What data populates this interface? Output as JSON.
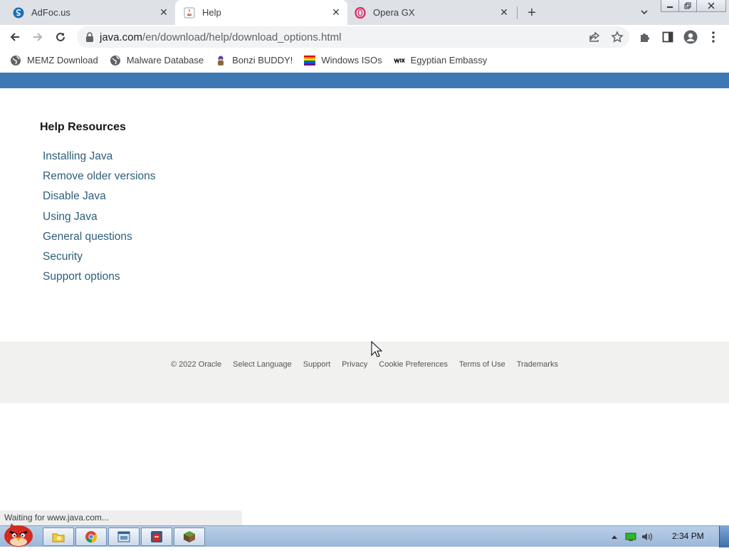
{
  "browser": {
    "tabs": [
      {
        "title": "AdFoc.us",
        "icon": "adfocus-icon",
        "active": false
      },
      {
        "title": "Help",
        "icon": "java-icon",
        "active": true
      },
      {
        "title": "Opera GX",
        "icon": "opera-icon",
        "active": false
      }
    ],
    "tab_close_glyph": "✕",
    "new_tab_glyph": "+",
    "url": {
      "host": "java.com",
      "path": "/en/download/help/download_options.html"
    },
    "bookmarks": [
      {
        "label": "MEMZ Download",
        "icon": "globe-icon"
      },
      {
        "label": "Malware Database",
        "icon": "globe-icon"
      },
      {
        "label": "Bonzi BUDDY!",
        "icon": "bonzi-icon"
      },
      {
        "label": "Windows ISOs",
        "icon": "rainbow-flag-icon"
      },
      {
        "label": "Egyptian Embassy",
        "icon": "wix-icon"
      }
    ]
  },
  "page": {
    "help_title": "Help Resources",
    "help_links": [
      "Installing Java",
      "Remove older versions",
      "Disable Java",
      "Using Java",
      "General questions",
      "Security",
      "Support options"
    ],
    "footer_links": [
      "© 2022 Oracle",
      "Select Language",
      "Support",
      "Privacy",
      "Cookie Preferences",
      "Terms of Use",
      "Trademarks"
    ],
    "banner_color": "#3f79b5",
    "link_color": "#2d5f7a"
  },
  "status": {
    "text": "Waiting for www.java.com..."
  },
  "taskbar": {
    "clock": "2:34 PM",
    "apps": [
      "explorer-icon",
      "chrome-icon",
      "window-icon",
      "angry-bird-icon",
      "minecraft-icon"
    ]
  }
}
